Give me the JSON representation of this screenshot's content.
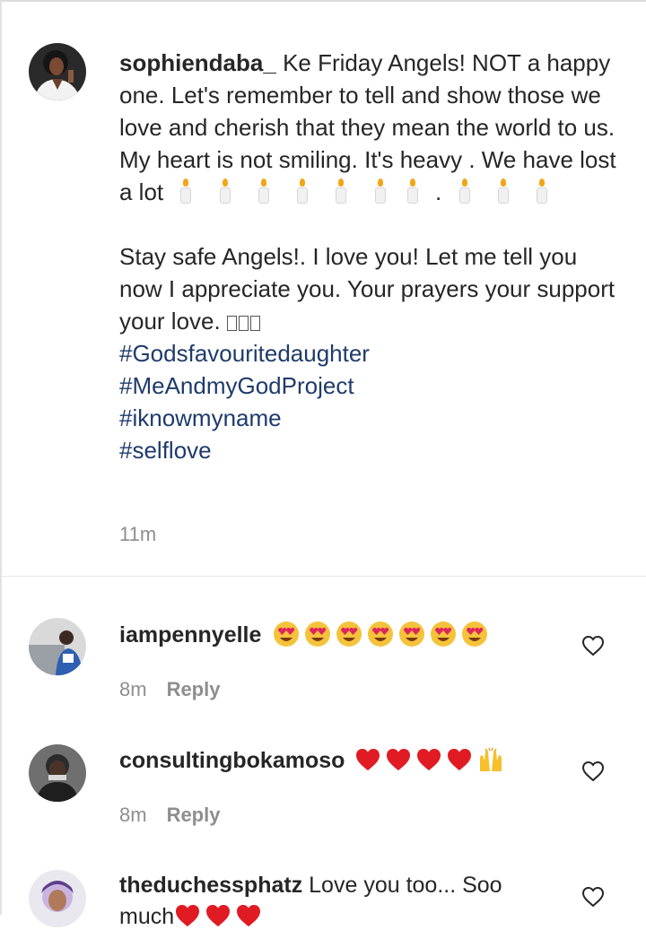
{
  "post": {
    "username": "sophiendaba_",
    "caption_line1": "Ke Friday Angels! NOT a happy one. Let's remember to tell and show those we love and cherish that they mean the world to us. My heart is not smiling. It's heavy . We have lost a lot",
    "caption_dot": ".",
    "caption_line2": "Stay safe Angels!. I love you! Let me tell you now I appreciate you. Your prayers your support your love.",
    "hashtags": [
      "#Godsfavouritedaughter",
      "#MeAndmyGodProject",
      "#iknowmyname",
      "#selflove"
    ],
    "time": "11m"
  },
  "comments": [
    {
      "username": "iampennyelle",
      "text": "",
      "time": "8m",
      "reply_label": "Reply",
      "emoji": "heart-eyes x7"
    },
    {
      "username": "consultingbokamoso",
      "text": "",
      "time": "8m",
      "reply_label": "Reply",
      "emoji": "red-heart x4, raising-hands"
    },
    {
      "username": "theduchessphatz",
      "text": "Love you too... Soo",
      "text_cont": "much",
      "emoji": "red-heart x3"
    }
  ],
  "icons": {
    "like": "heart-outline-icon",
    "candle": "candle-icon"
  },
  "colors": {
    "hashtag": "#1f3b6b",
    "meta": "#8e8e8e",
    "text": "#262626"
  }
}
